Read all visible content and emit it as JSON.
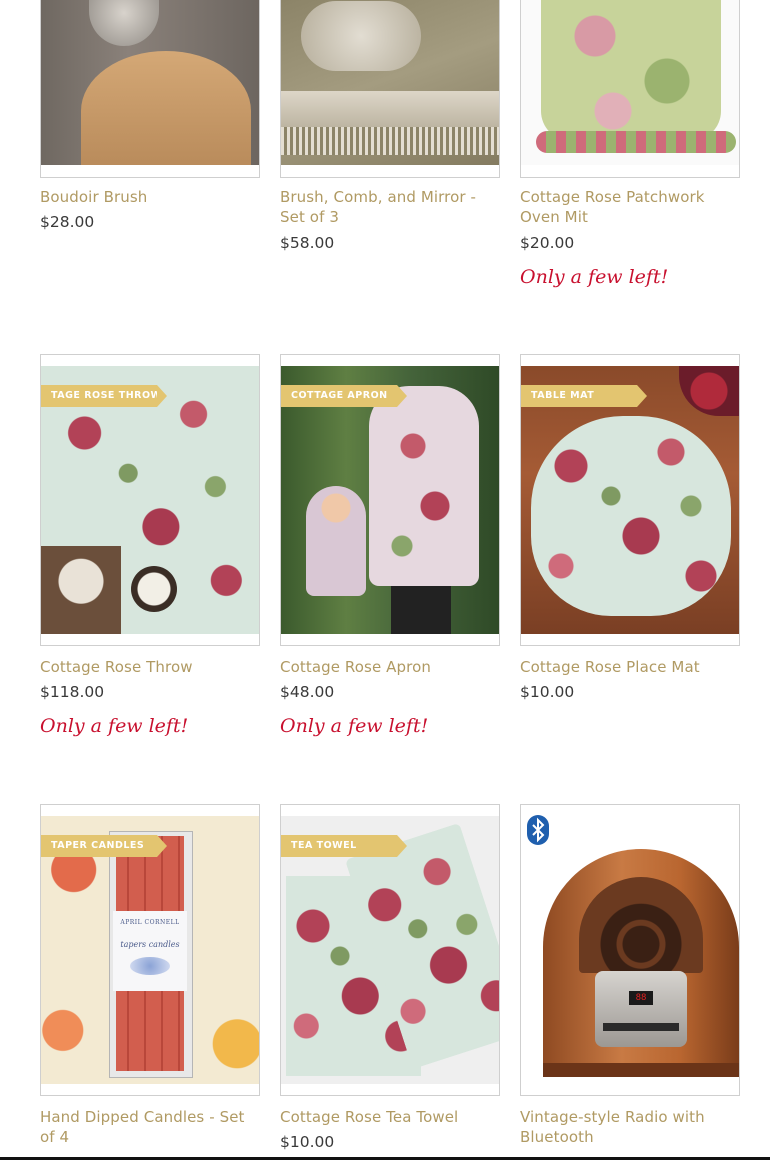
{
  "products": [
    {
      "title": "Boudoir Brush",
      "price": "$28.00",
      "stock_note": ""
    },
    {
      "title": "Brush, Comb, and Mirror - Set of 3",
      "price": "$58.00",
      "stock_note": ""
    },
    {
      "title": "Cottage Rose Patchwork Oven Mit",
      "price": "$20.00",
      "stock_note": "Only a few left!"
    },
    {
      "title": "Cottage Rose Throw",
      "price": "$118.00",
      "stock_note": "Only a few left!",
      "ribbon": "TAGE ROSE THROW"
    },
    {
      "title": "Cottage Rose Apron",
      "price": "$48.00",
      "stock_note": "Only a few left!",
      "ribbon": "COTTAGE APRON"
    },
    {
      "title": "Cottage Rose Place Mat",
      "price": "$10.00",
      "stock_note": "",
      "ribbon": "TABLE MAT"
    },
    {
      "title": "Hand Dipped Candles - Set of 4",
      "price": "",
      "stock_note": "",
      "ribbon": "TAPER CANDLES",
      "package_brand": "APRIL CORNELL",
      "package_label": "tapers candles"
    },
    {
      "title": "Cottage Rose Tea Towel",
      "price": "$10.00",
      "stock_note": "",
      "ribbon": "TEA TOWEL"
    },
    {
      "title": "Vintage-style Radio with Bluetooth",
      "price": "",
      "stock_note": "",
      "badge_icon": "bluetooth-icon",
      "radio_display": "88"
    }
  ],
  "colors": {
    "title": "#b09a63",
    "price": "#3a3a3a",
    "stock_note": "#c8102e",
    "ribbon": "#e3c570"
  }
}
